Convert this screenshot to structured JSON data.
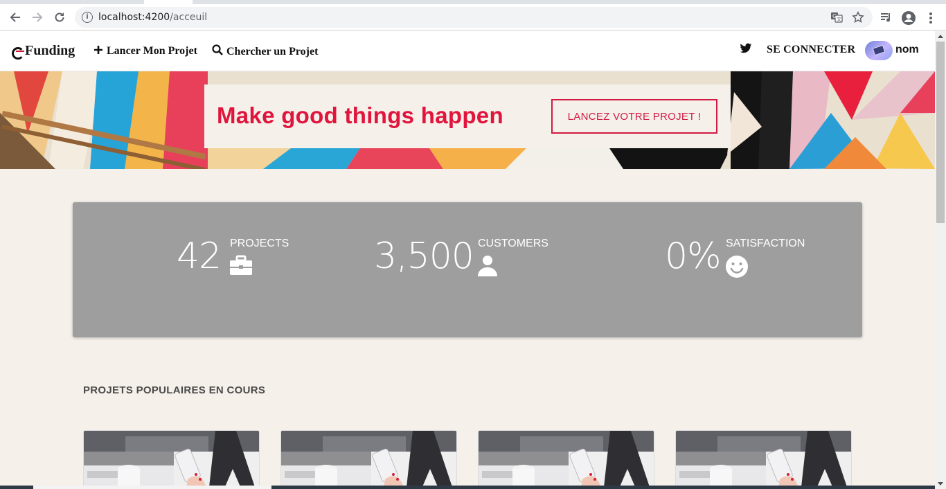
{
  "browser": {
    "url_host": "localhost:4200",
    "url_path": "/acceuil",
    "icons": [
      "back-icon",
      "forward-icon",
      "reload-icon",
      "info-icon",
      "translate-icon",
      "star-icon",
      "media-icon",
      "account-icon",
      "menu-icon"
    ]
  },
  "navbar": {
    "brand": "Funding",
    "launch_label": "Lancer Mon Projet",
    "search_label": "Chercher un Projet",
    "connect_label": "SE CONNECTER",
    "username": "nom"
  },
  "hero": {
    "title": "Make good things happen",
    "cta_label": "LANCEZ VOTRE PROJET !",
    "accent_color": "#e0143c"
  },
  "stats": [
    {
      "value": "42",
      "label": "PROJECTS",
      "icon": "briefcase-icon"
    },
    {
      "value": "3,500",
      "label": "CUSTOMERS",
      "icon": "user-icon"
    },
    {
      "value": "0%",
      "label": "SATISFACTION",
      "icon": "smile-icon"
    }
  ],
  "popular": {
    "title": "PROJETS POPULAIRES EN COURS",
    "card_count": 4
  }
}
